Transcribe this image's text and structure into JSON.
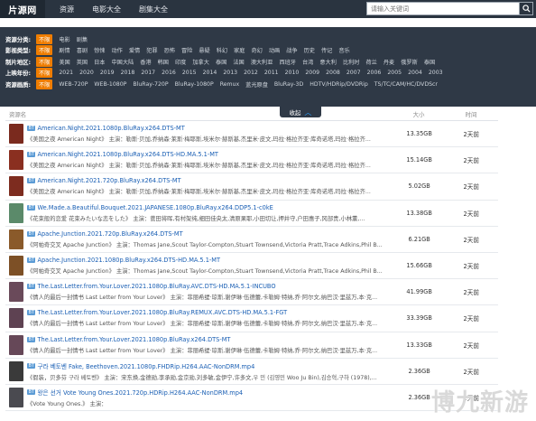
{
  "app": {
    "logo": "片源网"
  },
  "nav": {
    "items": [
      "资源",
      "电影大全",
      "剧集大全"
    ]
  },
  "search": {
    "placeholder": "请输入关键词"
  },
  "filters": [
    {
      "label": "资源分类:",
      "options": [
        "不限",
        "电影",
        "剧集"
      ]
    },
    {
      "label": "影视类型:",
      "options": [
        "不限",
        "剧情",
        "喜剧",
        "惊悚",
        "动作",
        "爱情",
        "犯罪",
        "恐怖",
        "冒险",
        "悬疑",
        "科幻",
        "家庭",
        "奇幻",
        "动画",
        "战争",
        "历史",
        "传记",
        "音乐"
      ]
    },
    {
      "label": "制片地区:",
      "options": [
        "不限",
        "美国",
        "英国",
        "日本",
        "中国大陆",
        "香港",
        "韩国",
        "印度",
        "加拿大",
        "泰国",
        "法国",
        "澳大利亚",
        "西班牙",
        "台湾",
        "意大利",
        "比利时",
        "荷兰",
        "丹麦",
        "俄罗斯",
        "泰国"
      ]
    },
    {
      "label": "上映年份:",
      "options": [
        "不限",
        "2021",
        "2020",
        "2019",
        "2018",
        "2017",
        "2016",
        "2015",
        "2014",
        "2013",
        "2012",
        "2011",
        "2010",
        "2009",
        "2008",
        "2007",
        "2006",
        "2005",
        "2004",
        "2003"
      ]
    },
    {
      "label": "资源画质:",
      "options": [
        "不限",
        "WEB-720P",
        "WEB-1080P",
        "BluRay-720P",
        "BluRay-1080P",
        "Remux",
        "蓝光原盘",
        "BluRay-3D",
        "HDTV/HDRip/DVDRip",
        "TS/TC/CAM/HC/DVDScr"
      ]
    }
  ],
  "collapse": {
    "label": "收起",
    "icon": "chevron-up-icon"
  },
  "table": {
    "headers": {
      "name": "资源名",
      "size": "大小",
      "time": "时间"
    },
    "rows": [
      {
        "tag": "BT",
        "title": "American.Night.2021.1080p.BluRay.x264.DTS-MT",
        "desc": "《美国之夜 American Night》 主演：勒斯·贝加,乔纳森·莱斯·梅耶斯,埃米尔·赫斯基,杰里米·皮文,玛拉·格拉齐亚·库奇诺塔,玛拉·格拉齐...",
        "size": "13.35GB",
        "time": "2天前",
        "color": "#7a2a1e"
      },
      {
        "tag": "BT",
        "title": "American.Night.2021.1080p.BluRay.x264.DTS-HD.MA.5.1-MT",
        "desc": "《美国之夜 American Night》 主演：勒斯·贝加,乔纳森·莱斯·梅耶斯,埃米尔·赫斯基,杰里米·皮文,玛拉·格拉齐亚·库奇诺塔,玛拉·格拉齐...",
        "size": "15.14GB",
        "time": "2天前",
        "color": "#8a2f20"
      },
      {
        "tag": "BT",
        "title": "American.Night.2021.720p.BluRay.x264.DTS-MT",
        "desc": "《美国之夜 American Night》 主演：勒斯·贝加,乔纳森·莱斯·梅耶斯,埃米尔·赫斯基,杰里米·皮文,玛拉·格拉齐亚·库奇诺塔,玛拉·格拉齐...",
        "size": "5.02GB",
        "time": "2天前",
        "color": "#7d2c1f"
      },
      {
        "tag": "BT",
        "title": "We.Made.a.Beautiful.Bouquet.2021.JAPANESE.1080p.BluRay.x264.DDP5.1-c0kE",
        "desc": "《花束般的恋爱 花束みたいな恋をした》 主演：菅田将晖,有村架纯,细田佳央太,清原果耶,小田切让,押井守,户田惠子,冈部贵,小林薰,...",
        "size": "13.38GB",
        "time": "2天前",
        "color": "#5b8a6a"
      },
      {
        "tag": "BT",
        "title": "Apache.Junction.2021.720p.BluRay.x264.DTS-MT",
        "desc": "《阿帕奇交叉 Apache Junction》 主演：Thomas Jane,Scout Taylor-Compton,Stuart Townsend,Victoria Pratt,Trace Adkins,Phil B...",
        "size": "6.21GB",
        "time": "2天前",
        "color": "#8a5a2a"
      },
      {
        "tag": "BT",
        "title": "Apache.Junction.2021.1080p.BluRay.x264.DTS-HD.MA.5.1-MT",
        "desc": "《阿帕奇交叉 Apache Junction》 主演：Thomas Jane,Scout Taylor-Compton,Stuart Townsend,Victoria Pratt,Trace Adkins,Phil B...",
        "size": "15.66GB",
        "time": "2天前",
        "color": "#7d5026"
      },
      {
        "tag": "BT",
        "title": "The.Last.Letter.from.Your.Lover.2021.1080p.BluRay.AVC.DTS-HD.MA.5.1-INCUBO",
        "desc": "《情人的最后一封情书 Last Letter from Your Lover》 主演：菲丽希缇·琼斯,谢伊琳·伍德蕾,卡勒姆·特纳,乔·阿尔文,纳巴汉·里兹万,本·克...",
        "size": "41.99GB",
        "time": "2天前",
        "color": "#6a4a5a"
      },
      {
        "tag": "BT",
        "title": "The.Last.Letter.from.Your.Lover.2021.1080p.BluRay.REMUX.AVC.DTS-HD.MA.5.1-FGT",
        "desc": "《情人的最后一封情书 Last Letter from Your Lover》 主演：菲丽希缇·琼斯,谢伊琳·伍德蕾,卡勒姆·特纳,乔·阿尔文,纳巴汉·里兹万,本·克...",
        "size": "33.39GB",
        "time": "2天前",
        "color": "#5e4252"
      },
      {
        "tag": "BT",
        "title": "The.Last.Letter.from.Your.Lover.2021.1080p.BluRay.x264.DTS-MT",
        "desc": "《情人的最后一封情书 Last Letter from Your Lover》 主演：菲丽希缇·琼斯,谢伊琳·伍德蕾,卡勒姆·特纳,乔·阿尔文,纳巴汉·里兹万,本·克...",
        "size": "13.33GB",
        "time": "2天前",
        "color": "#664858"
      },
      {
        "tag": "BT",
        "title": "구라 베토벤 Fake, Beethoven.2021.1080p.FHDRip.H264.AAC-NonDRM.mp4",
        "desc": "《假装，贝多芬 구라 베토벤》 主演：宋东焕,金德勋,李承勋,金京勋,刘多敏,金伊宁,许多文,우 민 (김영민 Woo Ju Bin),김승혁,구하 (1978),...",
        "size": "2.36GB",
        "time": "2天前",
        "color": "#3a3a3a"
      },
      {
        "tag": "BT",
        "title": "왕은 선거 Vote Young Ones.2021.720p.HDRip.H264.AAC-NonDRM.mp4",
        "desc": "《Vote Young Ones.》 主演：",
        "size": "2.36GB",
        "time": "2天前",
        "color": "#4a4a50"
      }
    ]
  },
  "watermark": {
    "text": "博九新游"
  },
  "colors": {
    "accent": "#ef7d00",
    "nav_bg": "#2a3440",
    "link": "#1a5fb4"
  }
}
